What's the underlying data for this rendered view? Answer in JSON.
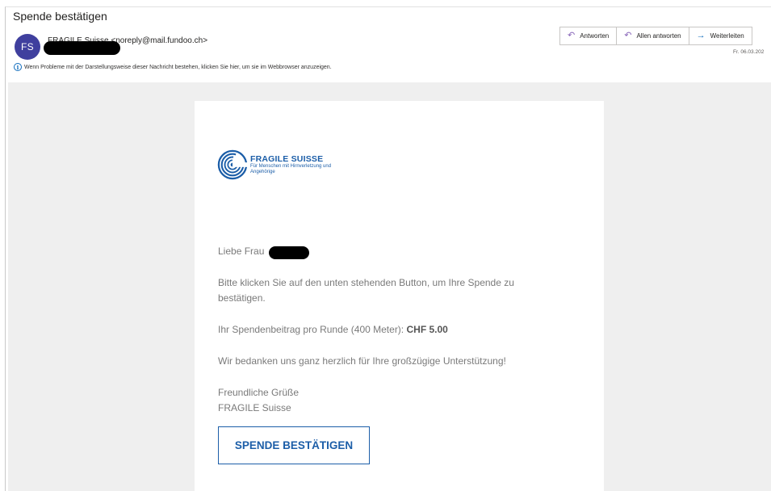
{
  "email": {
    "subject": "Spende bestätigen",
    "avatar_initials": "FS",
    "sender_name": "FRAGILE Suisse",
    "sender_address": "<noreply@mail.fundoo.ch>",
    "info_text": "Wenn Probleme mit der Darstellungsweise dieser Nachricht bestehen, klicken Sie hier, um sie im Webbrowser anzuzeigen.",
    "date": "Fr. 06.03.202"
  },
  "actions": {
    "reply": {
      "label": "Antworten",
      "icon": "reply-icon"
    },
    "reply_all": {
      "label": "Allen antworten",
      "icon": "reply-all-icon"
    },
    "forward": {
      "label": "Weiterleiten",
      "icon": "forward-icon"
    }
  },
  "logo": {
    "name": "FRAGILE SUISSE",
    "tagline": "Für Menschen mit Hirnverletzung und Angehörige",
    "color": "#1c5ea8"
  },
  "body": {
    "greeting": "Liebe Frau",
    "para1": "Bitte klicken Sie auf den unten stehenden Button, um Ihre Spende zu bestätigen.",
    "para2_prefix": "Ihr Spendenbeitrag pro Runde (400 Meter): ",
    "para2_amount": "CHF 5.00",
    "para3": "Wir bedanken uns ganz herzlich für Ihre großzügige Unterstützung!",
    "closing1": "Freundliche Grüße",
    "closing2": "FRAGILE Suisse",
    "button_label": "SPENDE BESTÄTIGEN"
  },
  "colors": {
    "accent": "#1c5ea8",
    "avatar_bg": "#3f3f9e",
    "body_background": "#efefef"
  }
}
